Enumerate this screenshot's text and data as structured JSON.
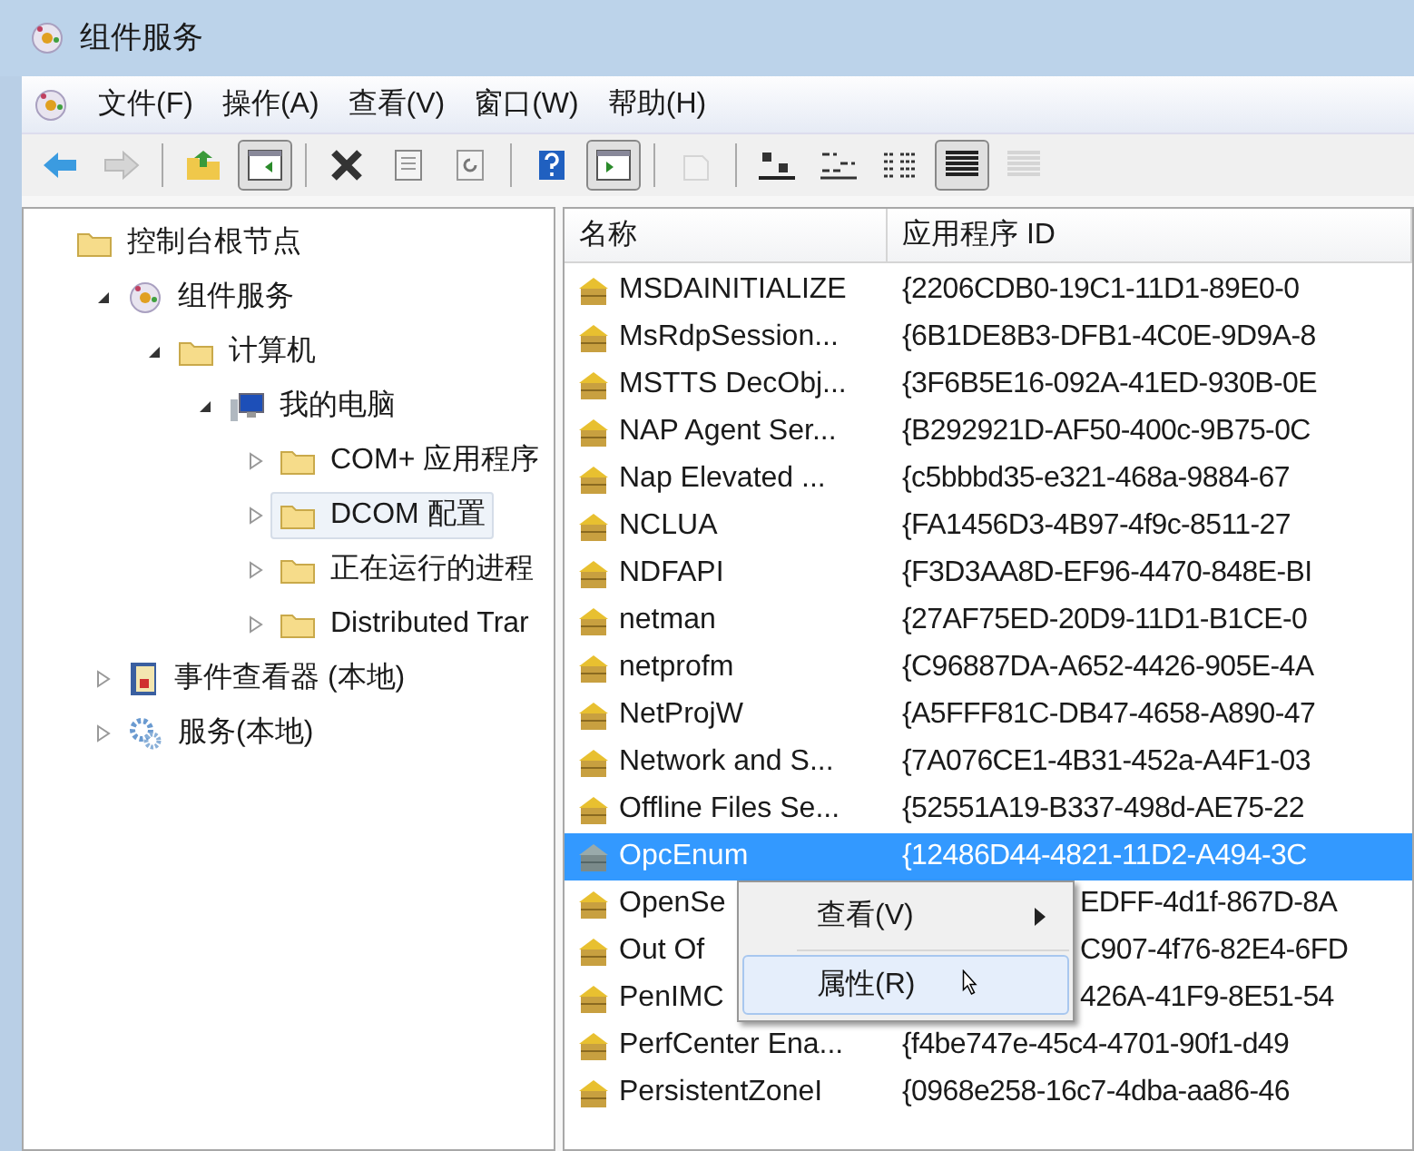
{
  "window": {
    "title": "组件服务"
  },
  "menu": [
    {
      "label": "文件(F)"
    },
    {
      "label": "操作(A)"
    },
    {
      "label": "查看(V)"
    },
    {
      "label": "窗口(W)"
    },
    {
      "label": "帮助(H)"
    }
  ],
  "toolbar": [
    {
      "kind": "back",
      "pressed": false,
      "disabled": false
    },
    {
      "kind": "forward",
      "pressed": false,
      "disabled": true
    },
    {
      "kind": "separator"
    },
    {
      "kind": "up",
      "pressed": false,
      "disabled": false
    },
    {
      "kind": "tree",
      "pressed": true,
      "disabled": false
    },
    {
      "kind": "separator"
    },
    {
      "kind": "delete",
      "pressed": false,
      "disabled": false
    },
    {
      "kind": "properties",
      "pressed": false,
      "disabled": false
    },
    {
      "kind": "refresh",
      "pressed": false,
      "disabled": false
    },
    {
      "kind": "separator"
    },
    {
      "kind": "help",
      "pressed": false,
      "disabled": false
    },
    {
      "kind": "pane",
      "pressed": true,
      "disabled": false
    },
    {
      "kind": "separator"
    },
    {
      "kind": "new",
      "pressed": false,
      "disabled": true
    },
    {
      "kind": "separator"
    },
    {
      "kind": "large",
      "pressed": false,
      "disabled": false
    },
    {
      "kind": "small",
      "pressed": false,
      "disabled": false
    },
    {
      "kind": "list",
      "pressed": false,
      "disabled": false
    },
    {
      "kind": "details",
      "pressed": true,
      "disabled": false
    },
    {
      "kind": "details",
      "pressed": false,
      "disabled": true
    }
  ],
  "tree": [
    {
      "label": "控制台根节点",
      "kind": "folder",
      "selected": false,
      "children": [
        {
          "label": "组件服务",
          "kind": "component",
          "expanded": true,
          "selected": false,
          "children": [
            {
              "label": "计算机",
              "kind": "folder",
              "expanded": true,
              "selected": false,
              "children": [
                {
                  "label": "我的电脑",
                  "kind": "computer",
                  "expanded": true,
                  "selected": false,
                  "children": [
                    {
                      "label": "COM+ 应用程序",
                      "kind": "folder",
                      "expanded": false,
                      "selected": false
                    },
                    {
                      "label": "DCOM 配置",
                      "kind": "folder",
                      "expanded": false,
                      "selected": true
                    },
                    {
                      "label": "正在运行的进程",
                      "kind": "folder",
                      "expanded": false,
                      "selected": false
                    },
                    {
                      "label": "Distributed Trar",
                      "kind": "folder",
                      "expanded": false,
                      "selected": false
                    }
                  ]
                }
              ]
            }
          ]
        },
        {
          "label": "事件查看器 (本地)",
          "kind": "events",
          "expanded": false,
          "selected": false
        },
        {
          "label": "服务(本地)",
          "kind": "gear",
          "expanded": false,
          "selected": false
        }
      ]
    }
  ],
  "table": {
    "columns": [
      "名称",
      "应用程序 ID"
    ],
    "rows": [
      {
        "name": "MSDAINITIALIZE",
        "app_id": "{2206CDB0-19C1-11D1-89E0-0",
        "selected": false,
        "covered": false
      },
      {
        "name": "MsRdpSession...",
        "app_id": "{6B1DE8B3-DFB1-4C0E-9D9A-8",
        "selected": false,
        "covered": false
      },
      {
        "name": "MSTTS DecObj...",
        "app_id": "{3F6B5E16-092A-41ED-930B-0E",
        "selected": false,
        "covered": false
      },
      {
        "name": "NAP Agent Ser...",
        "app_id": "{B292921D-AF50-400c-9B75-0C",
        "selected": false,
        "covered": false
      },
      {
        "name": "Nap Elevated ...",
        "app_id": "{c5bbbd35-e321-468a-9884-67",
        "selected": false,
        "covered": false
      },
      {
        "name": "NCLUA",
        "app_id": "{FA1456D3-4B97-4f9c-8511-27",
        "selected": false,
        "covered": false
      },
      {
        "name": "NDFAPI",
        "app_id": "{F3D3AA8D-EF96-4470-848E-BI",
        "selected": false,
        "covered": false
      },
      {
        "name": "netman",
        "app_id": "{27AF75ED-20D9-11D1-B1CE-0",
        "selected": false,
        "covered": false
      },
      {
        "name": "netprofm",
        "app_id": "{C96887DA-A652-4426-905E-4A",
        "selected": false,
        "covered": false
      },
      {
        "name": "NetProjW",
        "app_id": "{A5FFF81C-DB47-4658-A890-47",
        "selected": false,
        "covered": false
      },
      {
        "name": "Network and S...",
        "app_id": "{7A076CE1-4B31-452a-A4F1-03",
        "selected": false,
        "covered": false
      },
      {
        "name": "Offline Files Se...",
        "app_id": "{52551A19-B337-498d-AE75-22",
        "selected": false,
        "covered": false
      },
      {
        "name": "OpcEnum",
        "app_id": "{12486D44-4821-11D2-A494-3C",
        "selected": true,
        "covered": false
      },
      {
        "name": "OpenSe",
        "app_id": "EDFF-4d1f-867D-8A",
        "selected": false,
        "covered": true
      },
      {
        "name": "Out Of",
        "app_id": "C907-4f76-82E4-6FD",
        "selected": false,
        "covered": true
      },
      {
        "name": "PenIMC",
        "app_id": "426A-41F9-8E51-54",
        "selected": false,
        "covered": true
      },
      {
        "name": "PerfCenter Ena...",
        "app_id": "{f4be747e-45c4-4701-90f1-d49",
        "selected": false,
        "covered": false
      },
      {
        "name": "PersistentZoneI",
        "app_id": "{0968e258-16c7-4dba-aa86-46",
        "selected": false,
        "covered": false
      }
    ]
  },
  "context_menu": {
    "items": [
      {
        "label": "查看(V)",
        "submenu": true,
        "selected": false
      },
      {
        "label": "属性(R)",
        "submenu": false,
        "selected": true
      }
    ]
  }
}
